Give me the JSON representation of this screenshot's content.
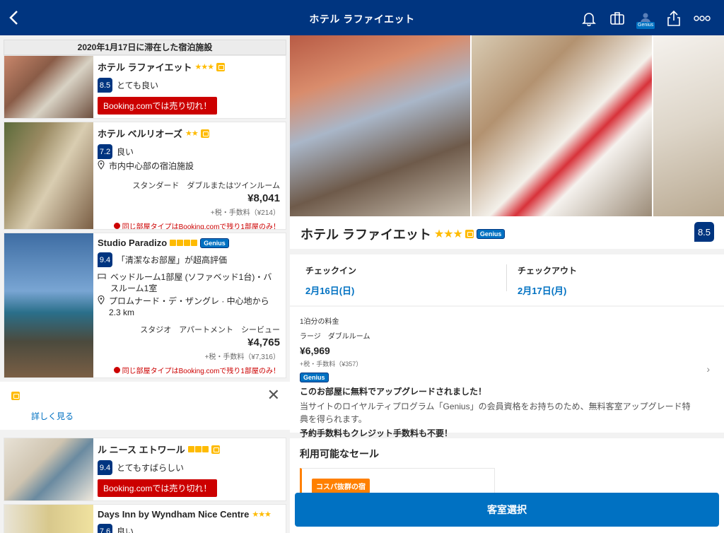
{
  "topbar": {
    "title": "ホテル ラファイエット",
    "genius_label": "Genius"
  },
  "list": {
    "section_title": "2020年1月17日に滞在した宿泊施設",
    "hotels": [
      {
        "name": "ホテル ラファイエット",
        "stars": "★★★",
        "score": "8.5",
        "score_text": "とても良い",
        "soldout": "Booking.comでは売り切れ！"
      },
      {
        "name": "ホテル ベルリオーズ",
        "stars": "★★",
        "score": "7.2",
        "score_text": "良い",
        "location": "市内中心部の宿泊施設",
        "room": "スタンダード　ダブルまたはツインルーム",
        "price": "¥8,041",
        "tax": "+税・手数料（¥214）",
        "scarcity": "同じ部屋タイプはBooking.comで残り1部屋のみ！"
      },
      {
        "name": "Studio Paradizo",
        "genius": "Genius",
        "score": "9.4",
        "score_text": "「清潔なお部屋」が超高評価",
        "beds": "ベッドルーム1部屋 (ソファベッド1台)・バスルーム1室",
        "location": "プロムナード・デ・ザングレ · 中心地から 2.3 km",
        "room": "スタジオ　アパートメント　シービュー",
        "price": "¥4,765",
        "tax": "+税・手数料（¥7,316）",
        "scarcity": "同じ部屋タイプはBooking.comで残り1部屋のみ！"
      },
      {
        "name": "ル ニース エトワール",
        "score": "9.4",
        "score_text": "とてもすばらしい",
        "soldout": "Booking.comでは売り切れ！"
      },
      {
        "name": "Days Inn by Wyndham Nice Centre",
        "stars": "★★★",
        "score": "7.6",
        "score_text": "良い"
      }
    ],
    "genius_banner_link": "詳しく見る"
  },
  "detail": {
    "name": "ホテル ラファイエット",
    "stars": "★★★",
    "genius": "Genius",
    "score": "8.5",
    "checkin_label": "チェックイン",
    "checkin_date": "2月16日(日)",
    "checkout_label": "チェックアウト",
    "checkout_date": "2月17日(月)",
    "rate_label": "1泊分の料金",
    "room": "ラージ　ダブルルーム",
    "price": "¥6,969",
    "tax": "+税・手数料（¥357）",
    "upgrade": "このお部屋に無料でアップグレードされました！",
    "desc": "当サイトのロイヤルティプログラム「Genius」の会員資格をお持ちのため、無料客室アップグレード特典を得られます。",
    "nofee": "予約手数料もクレジット手数料も不要！",
    "sales_title": "利用可能なセール",
    "deal_tag": "コスパ抜群の宿",
    "cta": "客室選択"
  },
  "colors": {
    "brand": "#003580",
    "accent": "#0071c2",
    "star": "#febb02",
    "alert": "#cc0000",
    "deal": "#ff8000"
  }
}
